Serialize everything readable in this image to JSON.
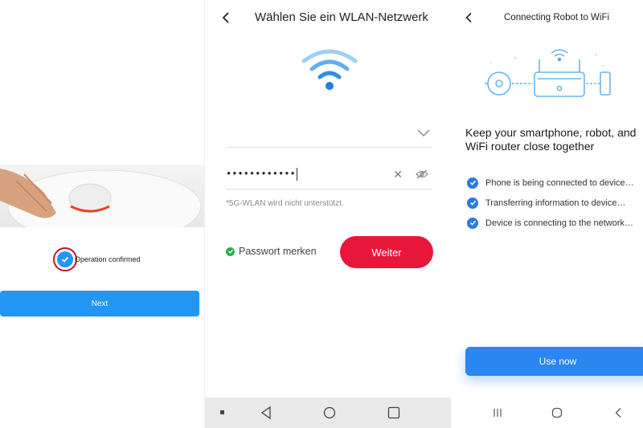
{
  "panel1": {
    "confirm_text": "Operation confirmed",
    "next_label": "Next"
  },
  "panel2": {
    "title": "Wählen Sie ein WLAN-Netzwerk",
    "password_value": "••••••••••••",
    "hint": "*5G-WLAN wird nicht unterstützt.",
    "remember_label": "Passwort merken",
    "weiter_label": "Weiter",
    "icons": [
      "back-arrow-icon",
      "wifi-icon",
      "chevron-down-icon",
      "clear-icon",
      "eye-hidden-icon"
    ]
  },
  "panel3": {
    "title": "Connecting Robot to WiFi",
    "heading": "Keep your smartphone, robot, and WiFi router close together",
    "steps": [
      "Phone is being connected to device…",
      "Transferring information to device…",
      "Device is connecting to the network…"
    ],
    "use_label": "Use now"
  },
  "colors": {
    "blue_button": "#2196f3",
    "red_button": "#e8173a",
    "green_check": "#22b14c",
    "accent_blue": "#2a86f0"
  }
}
